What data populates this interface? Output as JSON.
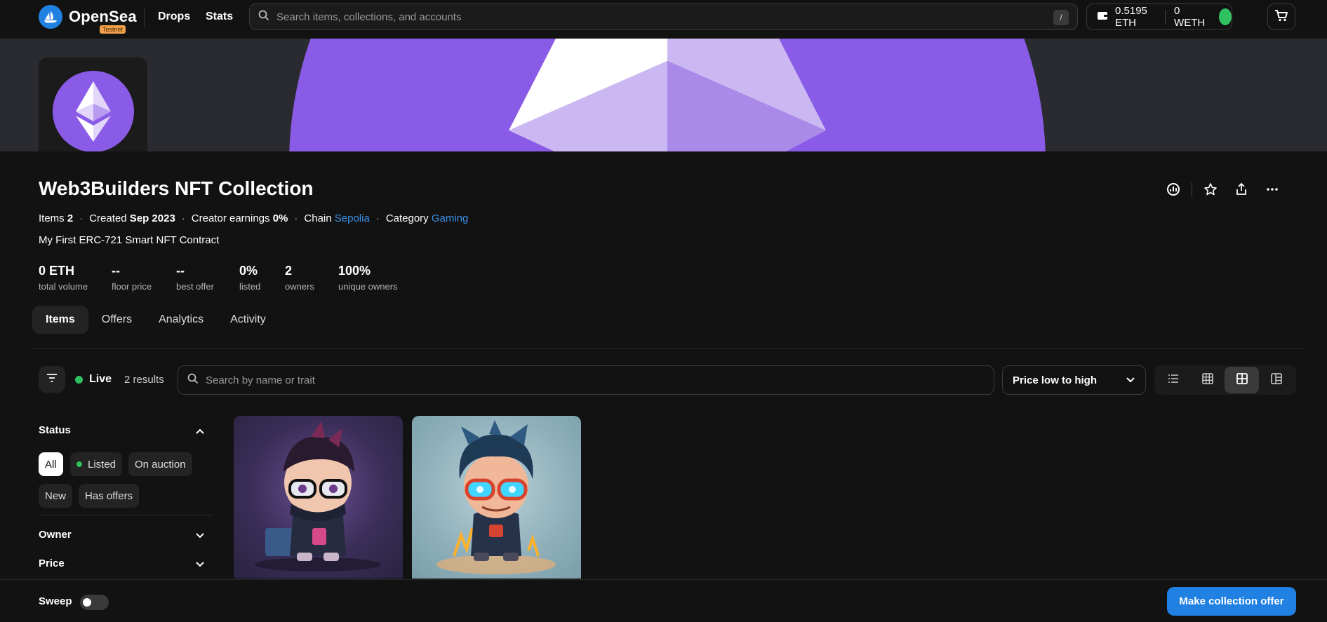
{
  "nav": {
    "brand": "OpenSea",
    "testnet_badge": "Testnet",
    "links": [
      "Drops",
      "Stats"
    ],
    "search_placeholder": "Search items, collections, and accounts",
    "search_shortcut": "/",
    "wallet_eth": "0.5195 ETH",
    "wallet_weth": "0 WETH"
  },
  "collection": {
    "title": "Web3Builders NFT Collection",
    "meta": {
      "items_label": "Items",
      "items_value": "2",
      "created_label": "Created",
      "created_value": "Sep 2023",
      "earnings_label": "Creator earnings",
      "earnings_value": "0%",
      "chain_label": "Chain",
      "chain_value": "Sepolia",
      "category_label": "Category",
      "category_value": "Gaming",
      "separator": "·"
    },
    "description": "My First ERC-721 Smart NFT Contract",
    "stats": [
      {
        "value": "0 ETH",
        "label": "total volume"
      },
      {
        "value": "--",
        "label": "floor price"
      },
      {
        "value": "--",
        "label": "best offer"
      },
      {
        "value": "0%",
        "label": "listed"
      },
      {
        "value": "2",
        "label": "owners"
      },
      {
        "value": "100%",
        "label": "unique owners"
      }
    ]
  },
  "tabs": [
    "Items",
    "Offers",
    "Analytics",
    "Activity"
  ],
  "filters": {
    "live_label": "Live",
    "results": "2 results",
    "search_placeholder": "Search by name or trait",
    "sort_value": "Price low to high"
  },
  "sidebar": {
    "status_title": "Status",
    "status_chips": [
      "All",
      "Listed",
      "On auction",
      "New",
      "Has offers"
    ],
    "owner_title": "Owner",
    "price_title": "Price"
  },
  "bottom": {
    "sweep_label": "Sweep",
    "offer_button": "Make collection offer"
  },
  "colors": {
    "accent": "#2081e2",
    "link": "#3b8fe6",
    "live_green": "#2fc160",
    "banner_purple": "#8a5be6",
    "testnet_orange": "#f0a04b",
    "background": "#121212"
  },
  "icons": [
    "opensea-logo-icon",
    "search-icon",
    "wallet-icon",
    "cart-icon",
    "ethereum-icon",
    "analytics-icon",
    "star-icon",
    "share-icon",
    "more-icon",
    "filter-icon",
    "chevron-down-icon",
    "chevron-up-icon",
    "list-view-icon",
    "grid-small-icon",
    "grid-large-icon",
    "grid-mixed-icon"
  ]
}
